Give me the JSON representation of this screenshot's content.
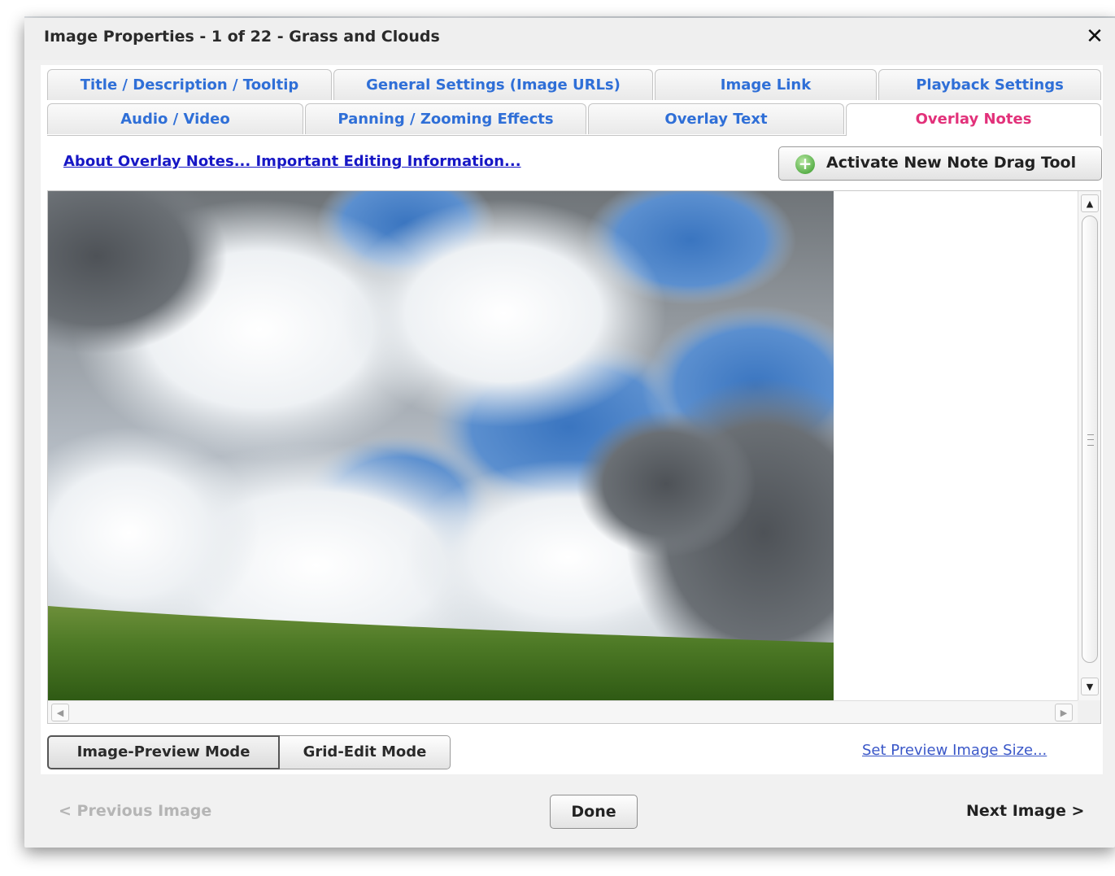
{
  "window": {
    "title": "Image Properties - 1 of 22 - Grass and Clouds",
    "close_glyph": "✕",
    "close_icon": "close-icon"
  },
  "tabs": {
    "row1": [
      {
        "label": "Title / Description / Tooltip"
      },
      {
        "label": "General Settings (Image URLs)"
      },
      {
        "label": "Image Link"
      },
      {
        "label": "Playback Settings"
      }
    ],
    "row2": [
      {
        "label": "Audio / Video"
      },
      {
        "label": "Panning / Zooming Effects"
      },
      {
        "label": "Overlay Text"
      },
      {
        "label": "Overlay Notes",
        "active": true
      }
    ],
    "tab_color": "#2f6fd7",
    "active_tab_color": "#e2317a"
  },
  "overlay_notes": {
    "info_link": "About Overlay Notes... Important Editing Information...",
    "drag_tool_button": "Activate New Note Drag Tool",
    "drag_tool_icon": "plus-circle-icon",
    "image": "Grass and Clouds"
  },
  "scrollbars": {
    "up_glyph": "▲",
    "down_glyph": "▼",
    "left_glyph": "◀",
    "right_glyph": "▶"
  },
  "modes": {
    "image_preview": "Image-Preview Mode",
    "grid_edit": "Grid-Edit Mode",
    "selected": "Image-Preview Mode"
  },
  "preview_size_link": "Set Preview Image Size...",
  "footer": {
    "previous": "< Previous Image",
    "previous_disabled": true,
    "done": "Done",
    "next": "Next Image >"
  },
  "colors": {
    "link": "#1717c5",
    "disabled_text": "#b5b5b5"
  }
}
